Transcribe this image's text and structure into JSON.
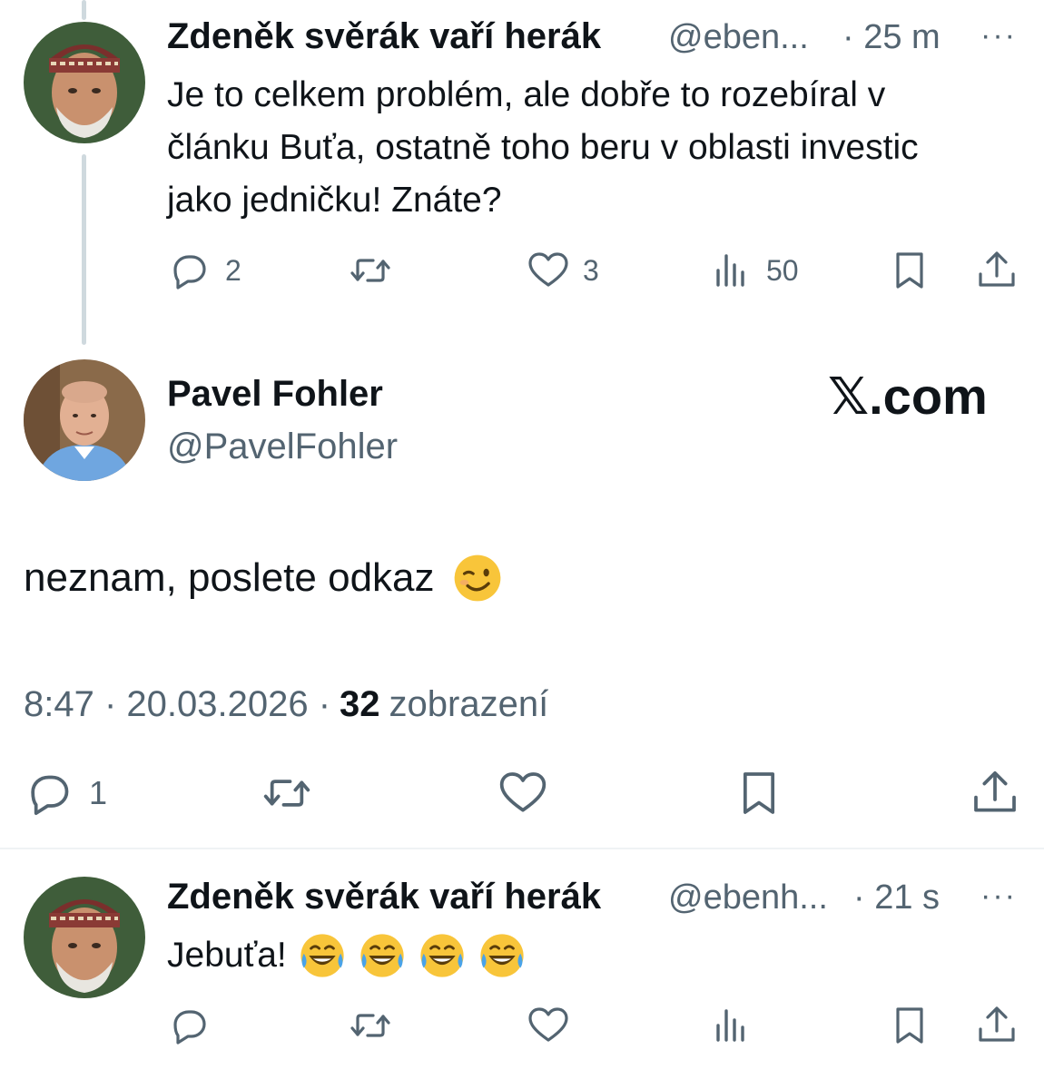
{
  "reply1": {
    "author_name": "Zdeněk svěrák vaří herák",
    "handle": "@eben...",
    "time": "· 25 m",
    "more": "···",
    "text": "Je to celkem problém, ale dobře to rozebíral v článku Buťa, ostatně toho beru v oblasti investic jako jedničku! Znáte?",
    "replies": "2",
    "likes": "3",
    "views": "50"
  },
  "main": {
    "author_name": "Pavel Fohler",
    "handle": "@PavelFohler",
    "watermark": "𝕏.com",
    "text": "neznam, poslete odkaz",
    "emoji": "winking-face",
    "time": "8:47 · 20.03.2026 ·",
    "views_count": "32",
    "views_label": "zobrazení",
    "replies": "1"
  },
  "reply2": {
    "author_name": "Zdeněk svěrák vaří herák",
    "handle": "@ebenh...",
    "time": "· 21 s",
    "more": "···",
    "text": "Jebuťa!",
    "emoji": "face-with-tears-of-joy"
  },
  "colors": {
    "text": "#0f1419",
    "secondary": "#536471",
    "thread_line": "#cfd9de",
    "divider": "#eff3f4"
  }
}
